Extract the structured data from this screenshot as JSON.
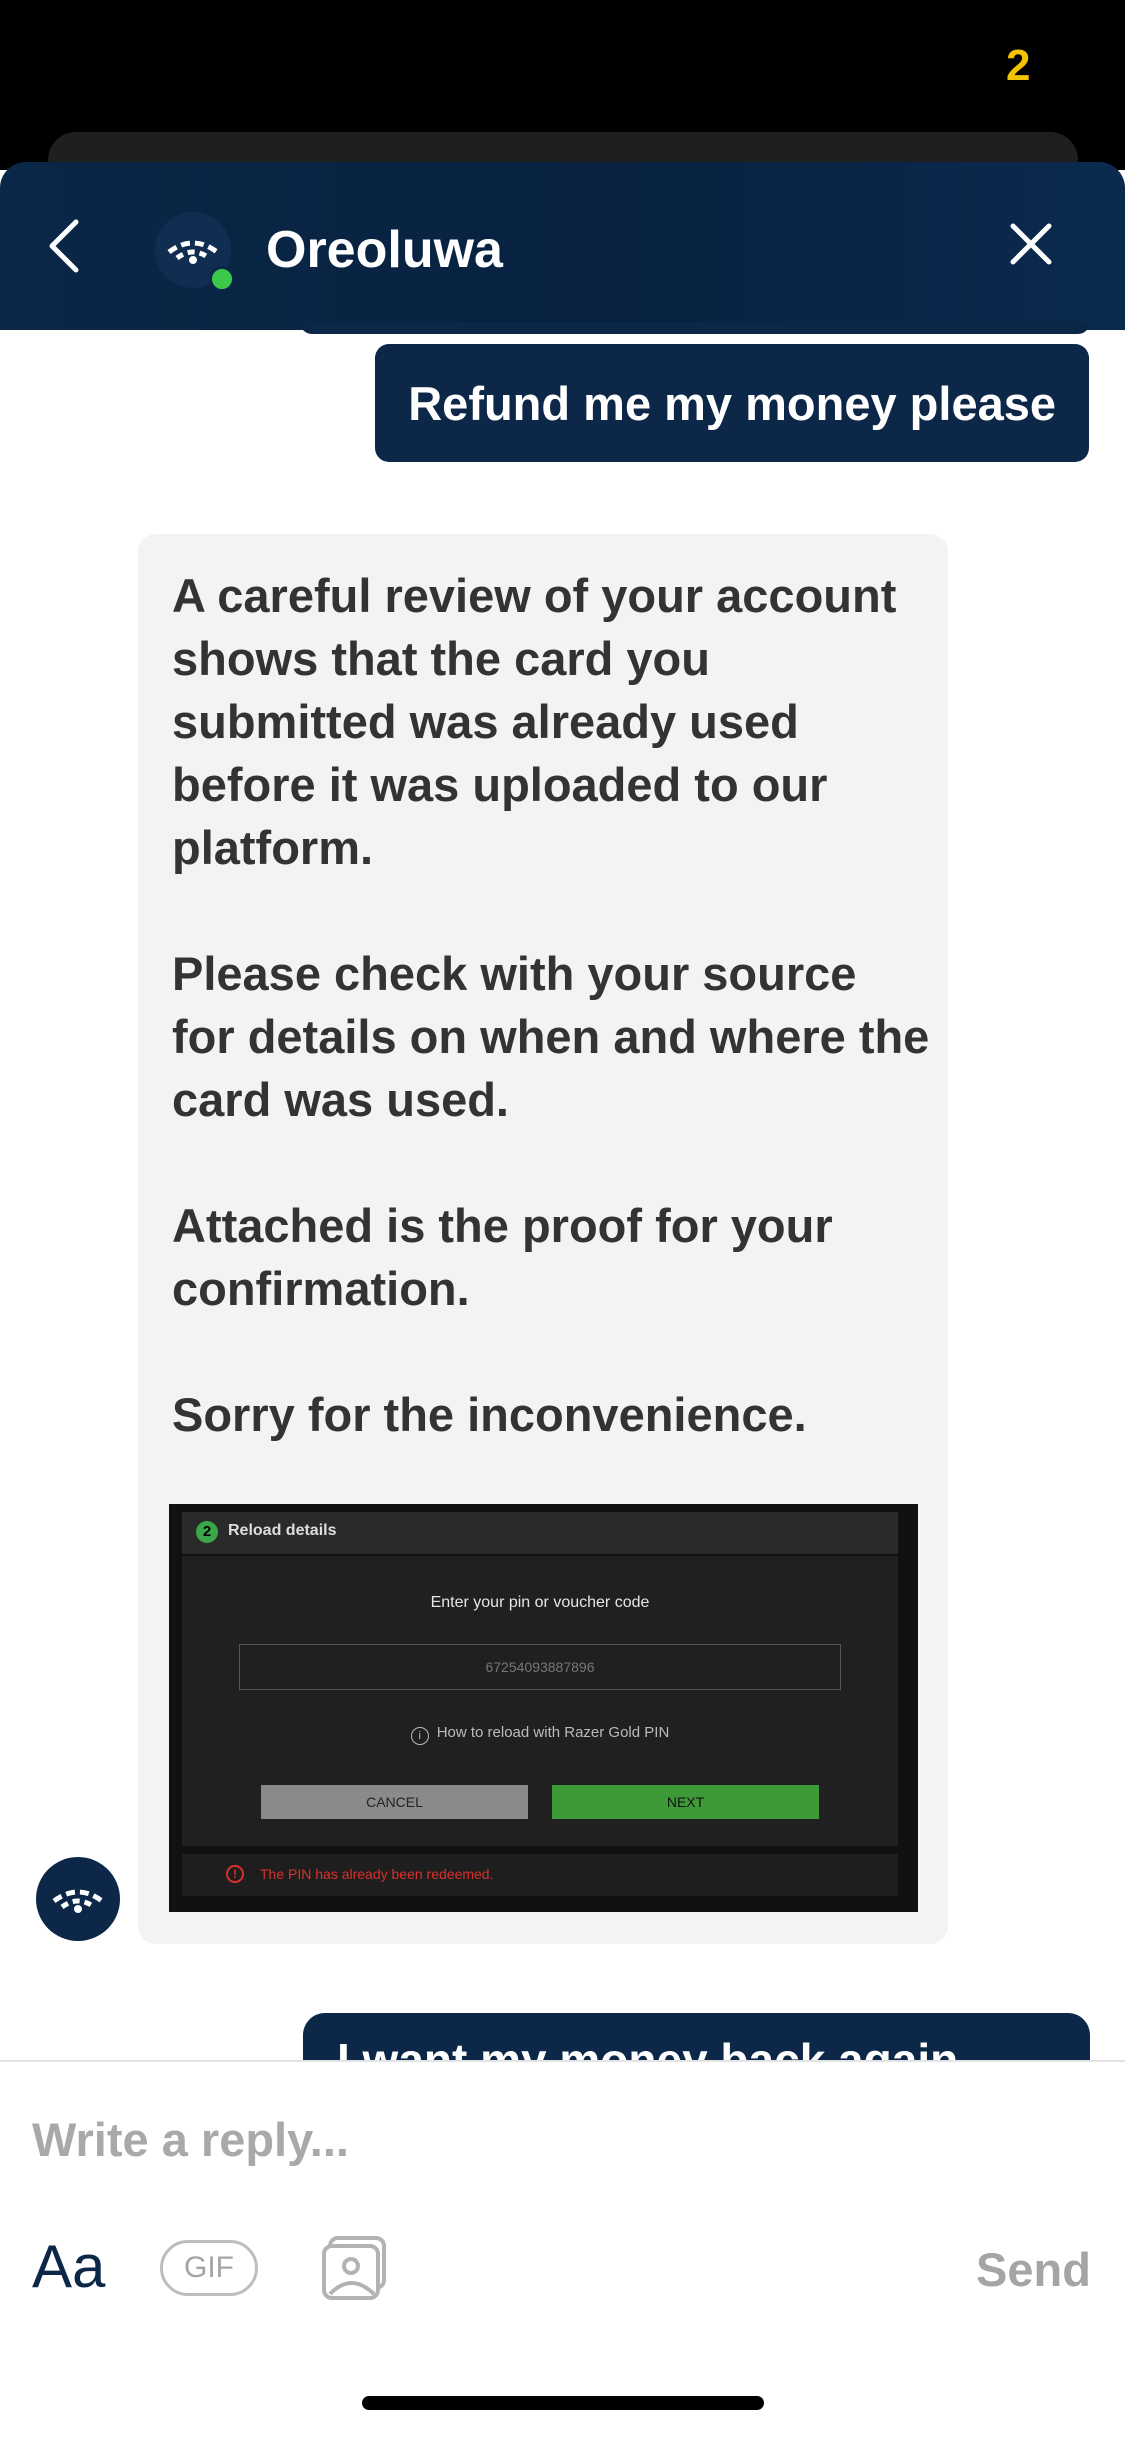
{
  "status_bar": {
    "glyph": "2"
  },
  "header": {
    "name": "Oreoluwa",
    "online": true,
    "icons": {
      "back": "chevron-left-icon",
      "close": "close-icon",
      "logo": "brand-logo-icon"
    }
  },
  "messages": {
    "user_1": "Refund me my money please",
    "agent_paragraphs": [
      "A careful review of your account shows that the card you submitted was already used before it was uploaded to our platform.",
      "Please check with your source for details on when and where the card was used.",
      "Attached is the proof for your confirmation.",
      "Sorry for the inconvenience."
    ],
    "attachment": {
      "step": "2",
      "title": "Reload details",
      "prompt": "Enter your pin or voucher code",
      "code": "67254093887896",
      "help": "How to reload with Razer Gold PIN",
      "cancel": "CANCEL",
      "next": "NEXT",
      "error": "The PIN has already been redeemed."
    },
    "user_2_partial": "I want my money back again"
  },
  "composer": {
    "placeholder": "Write a reply...",
    "aa_label": "Aa",
    "gif_label": "GIF",
    "send_label": "Send",
    "icons": {
      "image": "image-attach-icon"
    }
  },
  "colors": {
    "brand_navy": "#0c2747",
    "online_green": "#3cc94a",
    "error_red": "#d9302b",
    "next_green": "#3e9a38"
  }
}
